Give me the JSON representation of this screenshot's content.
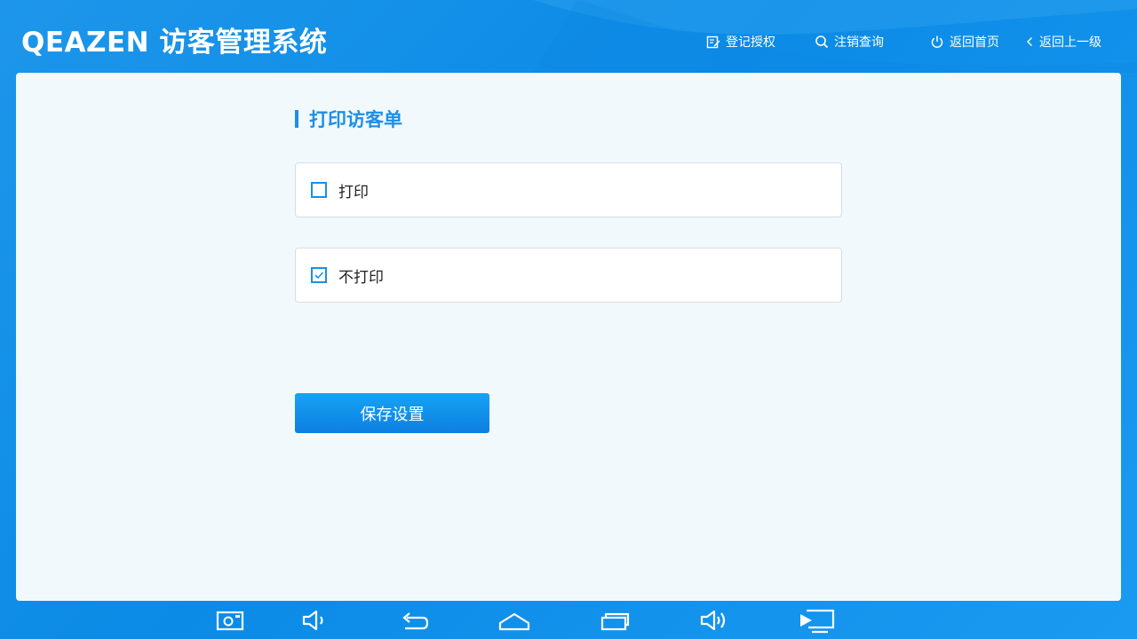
{
  "app": {
    "title": "QEAZEN 访客管理系统"
  },
  "header": {
    "nav": [
      {
        "label": "登记授权",
        "icon": "edit-icon"
      },
      {
        "label": "注销查询",
        "icon": "search-icon"
      },
      {
        "label": "返回首页",
        "icon": "power-icon"
      },
      {
        "label": "返回上一级",
        "icon": "chevron-left-icon"
      }
    ]
  },
  "main": {
    "section_title": "打印访客单",
    "options": [
      {
        "label": "打印",
        "checked": false
      },
      {
        "label": "不打印",
        "checked": true
      }
    ],
    "save_label": "保存设置"
  },
  "sysbar": {
    "buttons": [
      "screenshot-icon",
      "volume-down-icon",
      "back-icon",
      "home-icon",
      "recents-icon",
      "volume-up-icon",
      "screen-cast-icon"
    ]
  },
  "colors": {
    "accent": "#1b8fe8",
    "header_bg": "#0b8be6",
    "panel_bg": "#f2f9fc"
  }
}
